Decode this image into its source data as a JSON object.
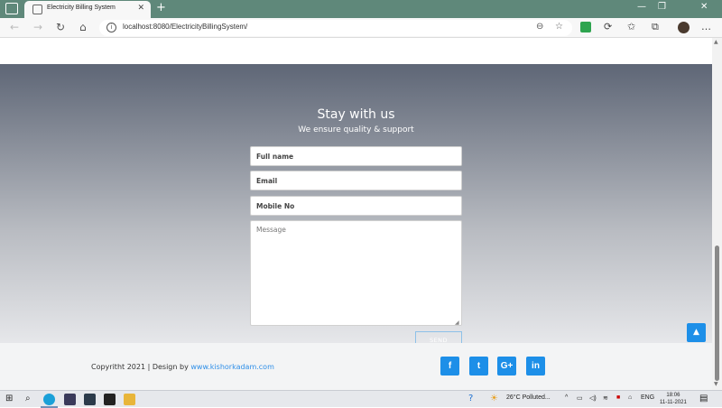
{
  "browser": {
    "tab_title": "Electricity Billing System",
    "tab_close": "✕",
    "new_tab": "+",
    "url": "localhost:8080/ElectricityBillingSystem/",
    "win_min": "—",
    "win_restore": "❐",
    "win_close": "✕"
  },
  "page": {
    "heading": "Stay with us",
    "subheading": "We ensure quality & support",
    "form": {
      "fullname_placeholder": "Full name",
      "email_placeholder": "Email",
      "mobile_placeholder": "Mobile No",
      "message_placeholder": "Message",
      "send_label": "SEND"
    },
    "footer": {
      "copyright_prefix": "Copyritht 2021 | Design by ",
      "designer_link": "www.kishorkadam.com",
      "social": {
        "facebook": "f",
        "twitter": "t",
        "google": "G+",
        "linkedin": "in"
      },
      "to_top": "▲"
    }
  },
  "taskbar": {
    "weather": "26°C  Polluted...",
    "lang": "ENG",
    "time": "18:06",
    "date": "11-11-2021"
  },
  "colors": {
    "accent": "#1d8fe8",
    "tabbar": "#5f887a"
  }
}
